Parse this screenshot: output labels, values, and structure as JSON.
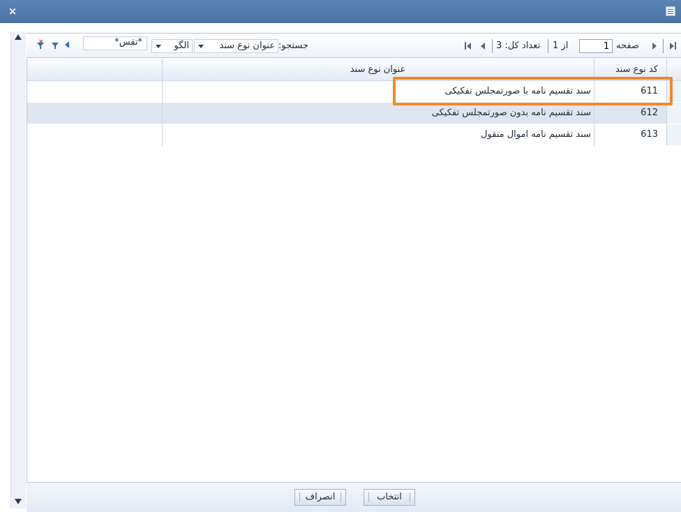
{
  "window": {
    "close_label": "×"
  },
  "toolbar": {
    "page_label": "صفحه",
    "page_value": "1",
    "of_label": "از 1",
    "total_label": "تعداد کل: 3",
    "search_label": "جستجو:",
    "search_field": "عنوان نوع سند",
    "pattern_label": "الگو",
    "search_value": "*تقس*"
  },
  "grid": {
    "headers": {
      "code": "کد نوع سند",
      "title": "عنوان نوع سند"
    },
    "rows": [
      {
        "code": "611",
        "title": "سند تقسیم نامه با صورتمجلس تفکیکی"
      },
      {
        "code": "612",
        "title": "سند تقسیم نامه بدون صورتمجلس تفکیکی"
      },
      {
        "code": "613",
        "title": "سند تقسیم نامه اموال منقول"
      }
    ]
  },
  "footer": {
    "select_label": "انتخاب",
    "cancel_label": "انصراف"
  },
  "colors": {
    "titlebar": "#4a74a6",
    "highlight": "#ef8a2c",
    "alt_row": "#dfe5ee"
  }
}
